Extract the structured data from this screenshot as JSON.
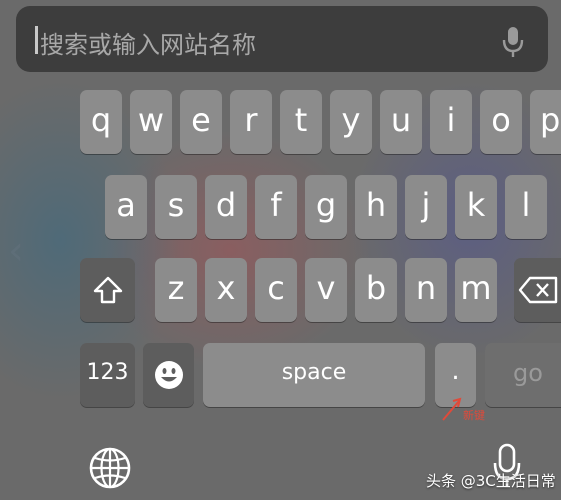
{
  "search": {
    "placeholder": "搜索或输入网站名称",
    "icon": "microphone-icon"
  },
  "keyboard": {
    "row1": [
      "q",
      "w",
      "e",
      "r",
      "t",
      "y",
      "u",
      "i",
      "o",
      "p"
    ],
    "row2": [
      "a",
      "s",
      "d",
      "f",
      "g",
      "h",
      "j",
      "k",
      "l"
    ],
    "row3": [
      "z",
      "x",
      "c",
      "v",
      "b",
      "n",
      "m"
    ],
    "numbers_label": "123",
    "space_label": "space",
    "period_label": ".",
    "go_label": "go",
    "shift_icon": "shift-icon",
    "backspace_icon": "backspace-icon",
    "emoji_icon": "emoji-icon",
    "globe_icon": "globe-icon",
    "dictation_icon": "microphone-icon"
  },
  "annotation": {
    "text": "新键",
    "color": "#e04a3a"
  },
  "watermark": {
    "text": "头条 @3C生活日常"
  }
}
